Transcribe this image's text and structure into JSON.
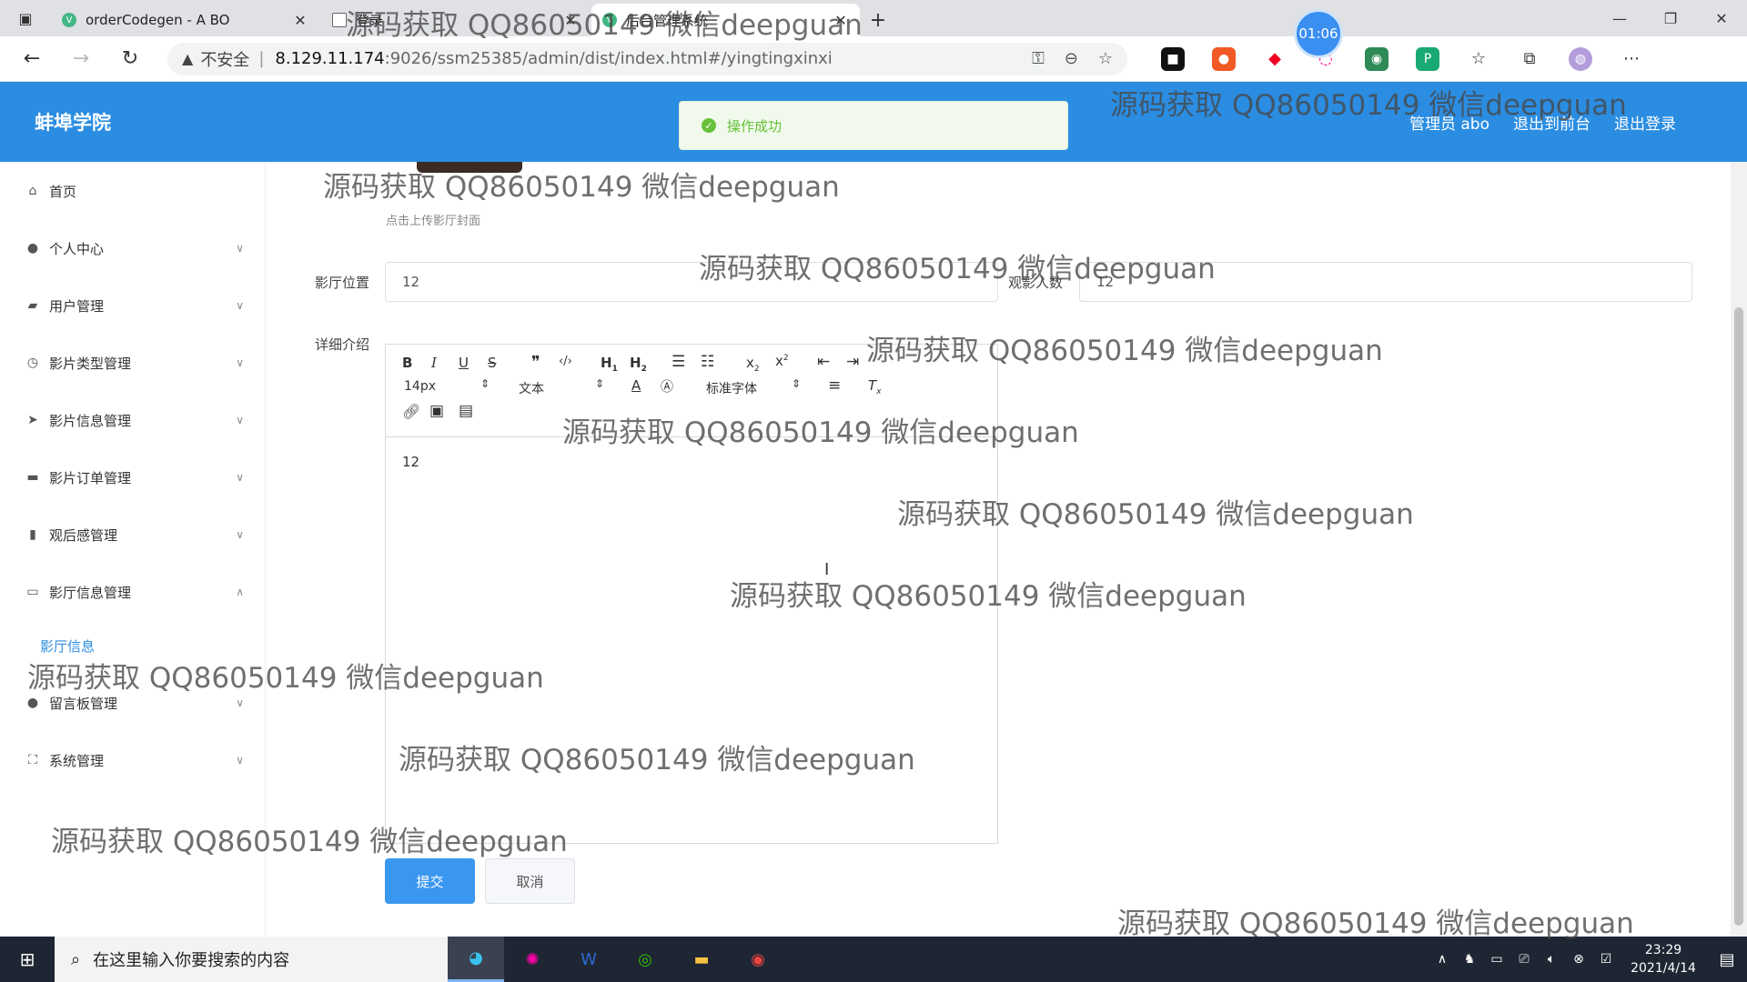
{
  "browser": {
    "tabs": [
      {
        "title": "orderCodegen - A BO",
        "active": false
      },
      {
        "title": "登录",
        "active": false
      },
      {
        "title": "后台管理系统",
        "active": true
      }
    ],
    "timer": "01:06",
    "url_warning": "不安全",
    "url_host": "8.129.11.174",
    "url_path": ":9026/ssm25385/admin/dist/index.html#/yingtingxinxi"
  },
  "header": {
    "brand": "蚌埠学院",
    "user": "管理员 abo",
    "to_front": "退出到前台",
    "logout": "退出登录"
  },
  "toast": {
    "message": "操作成功"
  },
  "sidebar": {
    "items": [
      {
        "label": "首页",
        "icon": "home-icon"
      },
      {
        "label": "个人中心",
        "icon": "user-icon"
      },
      {
        "label": "用户管理",
        "icon": "chart-icon"
      },
      {
        "label": "影片类型管理",
        "icon": "clock-icon"
      },
      {
        "label": "影片信息管理",
        "icon": "send-icon"
      },
      {
        "label": "影片订单管理",
        "icon": "briefcase-icon"
      },
      {
        "label": "观后感管理",
        "icon": "bar-chart-icon"
      },
      {
        "label": "影厅信息管理",
        "icon": "message-icon"
      },
      {
        "label": "留言板管理",
        "icon": "bulb-icon"
      },
      {
        "label": "系统管理",
        "icon": "expand-icon"
      }
    ],
    "sub_item": "影厅信息"
  },
  "form": {
    "upload_hint": "点击上传影厅封面",
    "position_label": "影厅位置",
    "position_value": "12",
    "viewers_label": "观影人数",
    "viewers_value": "12",
    "detail_label": "详细介绍",
    "editor_content": "12",
    "font_size": "14px",
    "text_style": "文本",
    "font_family": "标准字体",
    "submit": "提交",
    "cancel": "取消"
  },
  "watermark": "源码获取 QQ86050149 微信deepguan",
  "taskbar": {
    "search_placeholder": "在这里输入你要搜索的内容",
    "time": "23:29",
    "date": "2021/4/14"
  }
}
